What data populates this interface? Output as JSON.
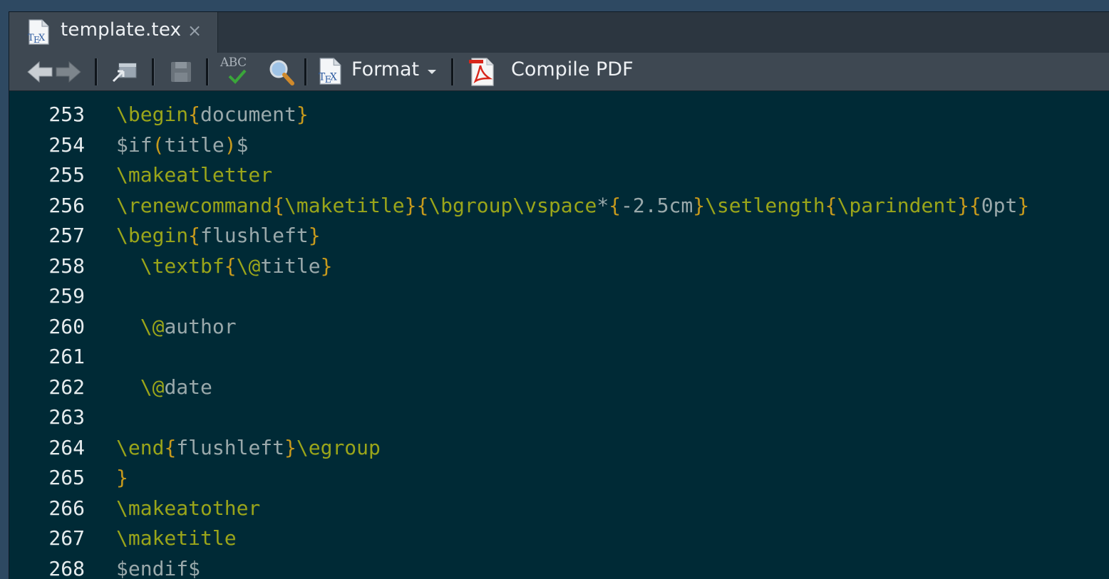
{
  "tab": {
    "label": "template.tex",
    "close": "×"
  },
  "toolbar": {
    "format_label": "Format",
    "compile_label": "Compile PDF",
    "spell_label": "ABC"
  },
  "colors": {
    "editor_bg": "#002a36",
    "command": "#9aa51a",
    "bracket": "#c79a1c",
    "text": "#9aa9ab",
    "line_number": "#e6ecee"
  },
  "editor": {
    "lines": [
      {
        "num": "253",
        "tokens": [
          [
            "cmd",
            "\\begin"
          ],
          [
            "br",
            "{"
          ],
          [
            "txt",
            "document"
          ],
          [
            "br",
            "}"
          ]
        ]
      },
      {
        "num": "254",
        "tokens": [
          [
            "txt",
            "$if"
          ],
          [
            "br",
            "("
          ],
          [
            "txt",
            "title"
          ],
          [
            "br",
            ")"
          ],
          [
            "txt",
            "$"
          ]
        ]
      },
      {
        "num": "255",
        "tokens": [
          [
            "cmd",
            "\\makeatletter"
          ]
        ]
      },
      {
        "num": "256",
        "tokens": [
          [
            "cmd",
            "\\renewcommand"
          ],
          [
            "br",
            "{"
          ],
          [
            "cmd",
            "\\maketitle"
          ],
          [
            "br",
            "}{"
          ],
          [
            "cmd",
            "\\bgroup\\vspace"
          ],
          [
            "txt",
            "*"
          ],
          [
            "br",
            "{"
          ],
          [
            "txt",
            "-2.5cm"
          ],
          [
            "br",
            "}"
          ],
          [
            "cmd",
            "\\setlength"
          ],
          [
            "br",
            "{"
          ],
          [
            "cmd",
            "\\parindent"
          ],
          [
            "br",
            "}{"
          ],
          [
            "txt",
            "0pt"
          ],
          [
            "br",
            "}"
          ]
        ]
      },
      {
        "num": "257",
        "tokens": [
          [
            "cmd",
            "\\begin"
          ],
          [
            "br",
            "{"
          ],
          [
            "txt",
            "flushleft"
          ],
          [
            "br",
            "}"
          ]
        ]
      },
      {
        "num": "258",
        "tokens": [
          [
            "txt",
            "  "
          ],
          [
            "cmd",
            "\\textbf"
          ],
          [
            "br",
            "{"
          ],
          [
            "cmd",
            "\\@"
          ],
          [
            "txt",
            "title"
          ],
          [
            "br",
            "}"
          ]
        ]
      },
      {
        "num": "259",
        "tokens": []
      },
      {
        "num": "260",
        "tokens": [
          [
            "txt",
            "  "
          ],
          [
            "cmd",
            "\\@"
          ],
          [
            "txt",
            "author"
          ]
        ]
      },
      {
        "num": "261",
        "tokens": []
      },
      {
        "num": "262",
        "tokens": [
          [
            "txt",
            "  "
          ],
          [
            "cmd",
            "\\@"
          ],
          [
            "txt",
            "date"
          ]
        ]
      },
      {
        "num": "263",
        "tokens": []
      },
      {
        "num": "264",
        "tokens": [
          [
            "cmd",
            "\\end"
          ],
          [
            "br",
            "{"
          ],
          [
            "txt",
            "flushleft"
          ],
          [
            "br",
            "}"
          ],
          [
            "cmd",
            "\\egroup"
          ]
        ]
      },
      {
        "num": "265",
        "tokens": [
          [
            "br",
            "}"
          ]
        ]
      },
      {
        "num": "266",
        "tokens": [
          [
            "cmd",
            "\\makeatother"
          ]
        ]
      },
      {
        "num": "267",
        "tokens": [
          [
            "cmd",
            "\\maketitle"
          ]
        ]
      },
      {
        "num": "268",
        "tokens": [
          [
            "txt",
            "$endif$"
          ]
        ]
      }
    ]
  }
}
